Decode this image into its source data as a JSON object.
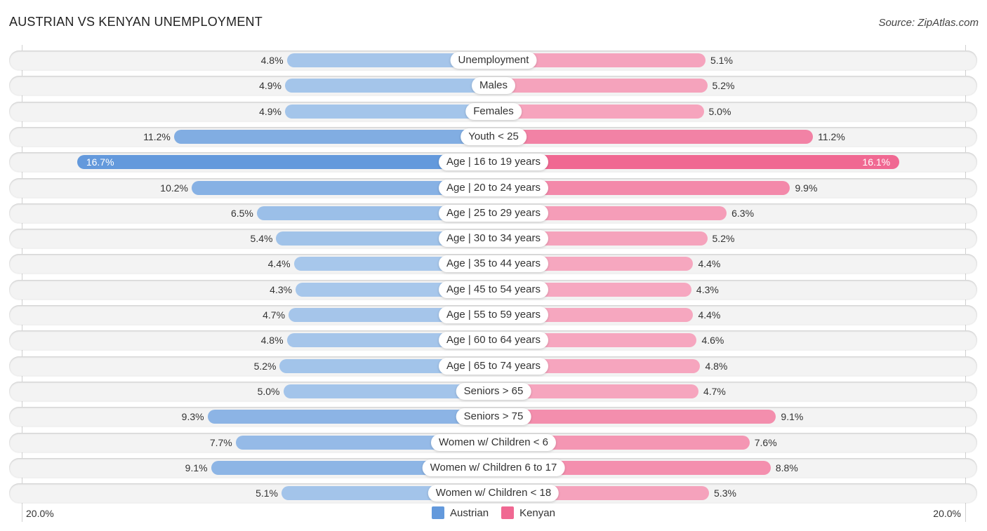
{
  "header": {
    "title": "AUSTRIAN VS KENYAN UNEMPLOYMENT",
    "source": "Source: ZipAtlas.com"
  },
  "colors": {
    "austrian_strong": "#6399dc",
    "austrian_light": "#a9c8eb",
    "kenyan_strong": "#f06892",
    "kenyan_light": "#f6a9c1"
  },
  "chart_data": {
    "type": "bar",
    "orientation": "horizontal-diverging",
    "title": "AUSTRIAN VS KENYAN UNEMPLOYMENT",
    "xlabel": "",
    "ylabel": "",
    "axis_min_label": "20.0%",
    "axis_max_label": "20.0%",
    "xlim": [
      0,
      20
    ],
    "legend_position": "bottom-center",
    "categories": [
      "Unemployment",
      "Males",
      "Females",
      "Youth < 25",
      "Age | 16 to 19 years",
      "Age | 20 to 24 years",
      "Age | 25 to 29 years",
      "Age | 30 to 34 years",
      "Age | 35 to 44 years",
      "Age | 45 to 54 years",
      "Age | 55 to 59 years",
      "Age | 60 to 64 years",
      "Age | 65 to 74 years",
      "Seniors > 65",
      "Seniors > 75",
      "Women w/ Children < 6",
      "Women w/ Children 6 to 17",
      "Women w/ Children < 18"
    ],
    "series": [
      {
        "name": "Austrian",
        "side": "left",
        "values": [
          4.8,
          4.9,
          4.9,
          11.2,
          16.7,
          10.2,
          6.5,
          5.4,
          4.4,
          4.3,
          4.7,
          4.8,
          5.2,
          5.0,
          9.3,
          7.7,
          9.1,
          5.1
        ],
        "labels": [
          "4.8%",
          "4.9%",
          "4.9%",
          "11.2%",
          "16.7%",
          "10.2%",
          "6.5%",
          "5.4%",
          "4.4%",
          "4.3%",
          "4.7%",
          "4.8%",
          "5.2%",
          "5.0%",
          "9.3%",
          "7.7%",
          "9.1%",
          "5.1%"
        ]
      },
      {
        "name": "Kenyan",
        "side": "right",
        "values": [
          5.1,
          5.2,
          5.0,
          11.2,
          16.1,
          9.9,
          6.3,
          5.2,
          4.4,
          4.3,
          4.4,
          4.6,
          4.8,
          4.7,
          9.1,
          7.6,
          8.8,
          5.3
        ],
        "labels": [
          "5.1%",
          "5.2%",
          "5.0%",
          "11.2%",
          "16.1%",
          "9.9%",
          "6.3%",
          "5.2%",
          "4.4%",
          "4.3%",
          "4.4%",
          "4.6%",
          "4.8%",
          "4.7%",
          "9.1%",
          "7.6%",
          "8.8%",
          "5.3%"
        ]
      }
    ]
  },
  "legend": [
    {
      "label": "Austrian"
    },
    {
      "label": "Kenyan"
    }
  ]
}
